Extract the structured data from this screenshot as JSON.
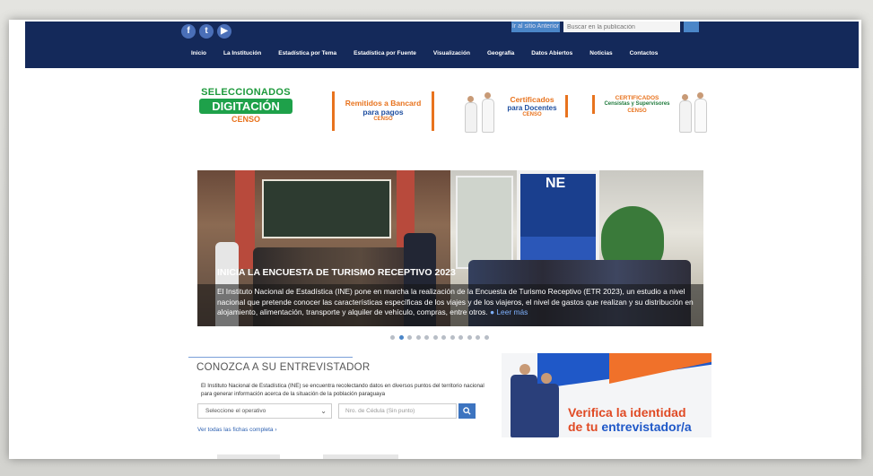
{
  "header": {
    "social": [
      "f",
      "t",
      "yt"
    ],
    "top_link": "Ir al sitio Anterior",
    "search_placeholder": "Buscar en la publicación",
    "nav": [
      "Inicio",
      "La Institución",
      "Estadística por Tema",
      "Estadística por Fuente",
      "Visualización",
      "Geografía",
      "Datos Abiertos",
      "Noticias",
      "Contactos"
    ]
  },
  "banners": {
    "b1": {
      "line1": "SELECCIONADOS",
      "line2": "DIGITACIÓN",
      "line3": "CENSO"
    },
    "b2": {
      "line1": "Remitidos a Bancard",
      "line2": "para pagos",
      "line3": "CENSO"
    },
    "b3": {
      "line1": "Certificados",
      "line2": "para Docentes",
      "line3": "CENSO"
    },
    "b4": {
      "line1": "CERTIFICADOS",
      "line2": "Censistas y Supervisores",
      "line3": "CENSO"
    }
  },
  "slider": {
    "title": "INICIA LA ENCUESTA DE TURISMO RECEPTIVO 2023",
    "text": "El Instituto Nacional de Estadística (INE) pone en marcha la realización de la Encuesta de Turismo Receptivo (ETR 2023), un estudio a nivel nacional que pretende conocer las características específicas de los viajes y de los viajeros, el nivel de gastos que realizan y su distribución en alojamiento, alimentación, transporte y alquiler de vehículo, compras, entre otros.",
    "more": "Leer más",
    "sign": "NE",
    "dot_count": 12,
    "active_dot": 1
  },
  "entrevistador": {
    "title": "CONOZCA A SU ENTREVISTADOR",
    "desc": "El Instituto Nacional de Estadística (INE) se encuentra recolectando datos en diversos puntos del territorio nacional para generar información acerca de la situación de la población paraguaya",
    "select": "Seleccione el operativo",
    "cedula_placeholder": "Nro. de Cédula (Sin punto)",
    "link": "Ver todas las fichas completa"
  },
  "promo": {
    "line1": "Verifica la identidad",
    "line2_pre": "de tu ",
    "line2_bold": "entrevistador/a"
  },
  "colors": {
    "navy": "#14295a",
    "accent": "#4b86c8",
    "orange": "#e8731e",
    "green": "#1ea14a"
  }
}
